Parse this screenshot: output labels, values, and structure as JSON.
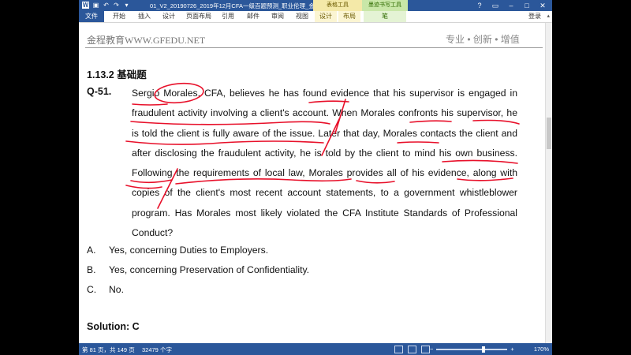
{
  "titlebar": {
    "title": "01_V2_20190726_2019年12月CFA一级百题预测_职业伦理_金…",
    "context_table": "表格工具",
    "context_ink": "墨迹书写工具",
    "quick_access": [
      "word-icon",
      "save-icon",
      "undo-icon",
      "redo-icon",
      "customize-icon"
    ]
  },
  "tabs": [
    "文件",
    "开始",
    "插入",
    "设计",
    "页面布局",
    "引用",
    "邮件",
    "审阅",
    "视图",
    "设计",
    "布局",
    "笔"
  ],
  "login": "登录",
  "doc": {
    "header_left": "金程教育WWW.GFEDU.NET",
    "header_right": "专业 • 创新 • 增值",
    "section": "1.13.2  基础题",
    "qnum": "Q-51.",
    "question": "Sergio Morales, CFA, believes he has found evidence that his supervisor is engaged in fraudulent activity involving a client's account. When Morales confronts his supervisor, he is told the client is fully aware of the issue. Later that day, Morales contacts the client and after disclosing the fraudulent activity, he is told by the client to mind his own business. Following the requirements of local law, Morales provides all of his evidence, along with copies of the client's most recent account statements, to a government whistleblower program. Has Morales most likely violated the CFA Institute Standards of Professional Conduct?",
    "options": [
      {
        "letter": "A.",
        "text": "Yes, concerning Duties to Employers."
      },
      {
        "letter": "B.",
        "text": "Yes, concerning Preservation of Confidentiality."
      },
      {
        "letter": "C.",
        "text": "No."
      }
    ],
    "solution": "Solution: C"
  },
  "status": {
    "page": "第 81 页，共 149 页",
    "words": "32479 个字",
    "zoom": "170%"
  },
  "colors": {
    "ribbon_blue": "#2b579a",
    "ink_red": "#e8102a"
  }
}
